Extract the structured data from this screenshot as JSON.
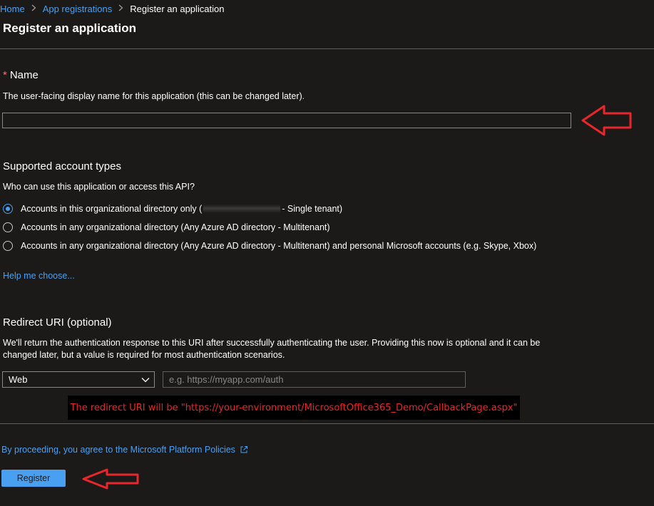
{
  "breadcrumb": {
    "items": [
      "Home",
      "App registrations"
    ],
    "current": "Register an application"
  },
  "page_title": "Register an application",
  "name_section": {
    "required_marker": "*",
    "label": "Name",
    "description": "The user-facing display name for this application (this can be changed later).",
    "value": "",
    "placeholder": ""
  },
  "account_types": {
    "heading": "Supported account types",
    "question": "Who can use this application or access this API?",
    "options": [
      {
        "label_prefix": "Accounts in this organizational directory only (",
        "label_suffix": " - Single tenant)",
        "checked": true
      },
      {
        "label": "Accounts in any organizational directory (Any Azure AD directory - Multitenant)",
        "checked": false
      },
      {
        "label": "Accounts in any organizational directory (Any Azure AD directory - Multitenant) and personal Microsoft accounts (e.g. Skype, Xbox)",
        "checked": false
      }
    ],
    "help_link": "Help me choose..."
  },
  "redirect": {
    "heading": "Redirect URI (optional)",
    "description_line1": "We'll return the authentication response to this URI after successfully authenticating the user. Providing this now is optional and it can be",
    "description_line2": "changed later, but a value is required for most authentication scenarios.",
    "platform_selected": "Web",
    "uri_placeholder": "e.g. https://myapp.com/auth",
    "uri_value": ""
  },
  "annotation": {
    "text": "The redirect URI will be \"https://your-environment/MicrosoftOffice365_Demo/CallbackPage.aspx\"",
    "color": "#e8262b"
  },
  "footer": {
    "policy_text": "By proceeding, you agree to the Microsoft Platform Policies",
    "register_label": "Register"
  },
  "colors": {
    "background": "#1b1a19",
    "link": "#4aa0f0",
    "primary_button": "#4aa0f0",
    "required": "#f1707b",
    "arrow": "#e8262b"
  }
}
